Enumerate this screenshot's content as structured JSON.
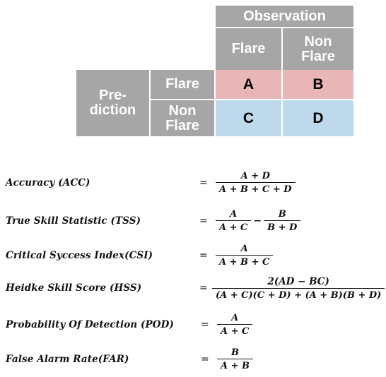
{
  "colors": {
    "header_grey": "#a6a6a6",
    "cell_pink": "#e8b6b6",
    "cell_blue": "#bed9ec",
    "header_text": "#ffffff",
    "body_text": "#000000",
    "background": "#ffffff"
  },
  "table": {
    "observation_header": "Observation",
    "observation_columns": [
      "Flare",
      "Non Flare"
    ],
    "prediction_header": "Pre-diction",
    "prediction_rows": [
      "Flare",
      "Non Flare"
    ],
    "cells": {
      "a": "A",
      "b": "B",
      "c": "C",
      "d": "D"
    }
  },
  "formulas": [
    {
      "id": "acc",
      "label": "Accuracy (ACC)",
      "equals": "=",
      "numerator": "A + D",
      "denominator": "A + B + C + D"
    },
    {
      "id": "tss",
      "label": "True Skill Statistic (TSS)",
      "equals": "=",
      "numerator": "A",
      "denominator": "A + C",
      "operator": "−",
      "numerator2": "B",
      "denominator2": "B + D"
    },
    {
      "id": "csi",
      "label": "Critical Syccess Index(CSI)",
      "equals": "=",
      "numerator": "A",
      "denominator": "A + B + C"
    },
    {
      "id": "hss",
      "label": "Heidke Skill Score (HSS)",
      "equals": "=",
      "numerator": "2(AD − BC)",
      "denominator": "(A + C)(C + D) + (A + B)(B + D)"
    },
    {
      "id": "pod",
      "label": "Probability Of Detection (POD)",
      "equals": "=",
      "numerator": "A",
      "denominator": "A + C"
    },
    {
      "id": "far",
      "label": "False Alarm Rate(FAR)",
      "equals": "=",
      "numerator": "B",
      "denominator": "A + B"
    }
  ]
}
